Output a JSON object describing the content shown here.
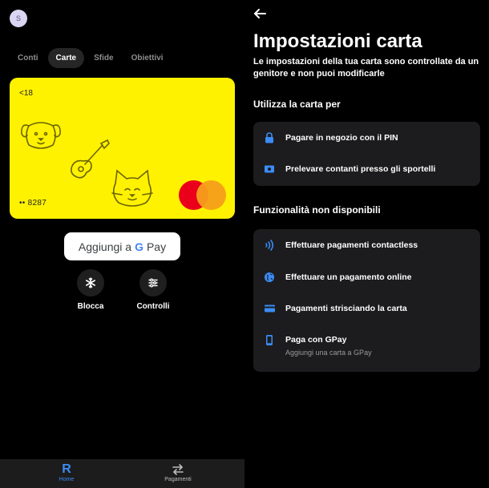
{
  "left": {
    "avatar_initial": "S",
    "tabs": [
      {
        "label": "Conti",
        "active": false
      },
      {
        "label": "Carte",
        "active": true
      },
      {
        "label": "Sfide",
        "active": false
      },
      {
        "label": "Obiettivi",
        "active": false
      }
    ],
    "card": {
      "age_label": "<18",
      "masked_number": "•• 8287",
      "color": "#fff200"
    },
    "gpay_button": {
      "prefix": "Aggiungi a",
      "g": "G",
      "pay": "Pay"
    },
    "actions": [
      {
        "label": "Blocca",
        "icon": "snowflake-icon"
      },
      {
        "label": "Controlli",
        "icon": "sliders-icon"
      }
    ],
    "bottom_nav": [
      {
        "label": "Home",
        "icon": "revolut-r-icon",
        "active": true
      },
      {
        "label": "Pagamenti",
        "icon": "transfer-arrows-icon",
        "active": false
      }
    ]
  },
  "right": {
    "title": "Impostazioni carta",
    "subtitle": "Le impostazioni della tua carta sono controllate da un genitore e non puoi modificarle",
    "section_enabled": {
      "heading": "Utilizza la carta per",
      "items": [
        {
          "label": "Pagare in negozio con il PIN",
          "icon": "lock-icon"
        },
        {
          "label": "Prelevare contanti presso gli sportelli",
          "icon": "cash-icon"
        }
      ]
    },
    "section_disabled": {
      "heading": "Funzionalità non disponibili",
      "items": [
        {
          "label": "Effettuare pagamenti contactless",
          "icon": "contactless-icon"
        },
        {
          "label": "Effettuare un pagamento online",
          "icon": "globe-icon"
        },
        {
          "label": "Pagamenti strisciando la carta",
          "icon": "card-swipe-icon"
        },
        {
          "label": "Paga con GPay",
          "sub": "Aggiungi una carta a GPay",
          "icon": "phone-icon"
        }
      ]
    }
  },
  "colors": {
    "accent": "#3b8cf6",
    "card_yellow": "#fff200",
    "panel": "#1c1c1e"
  }
}
